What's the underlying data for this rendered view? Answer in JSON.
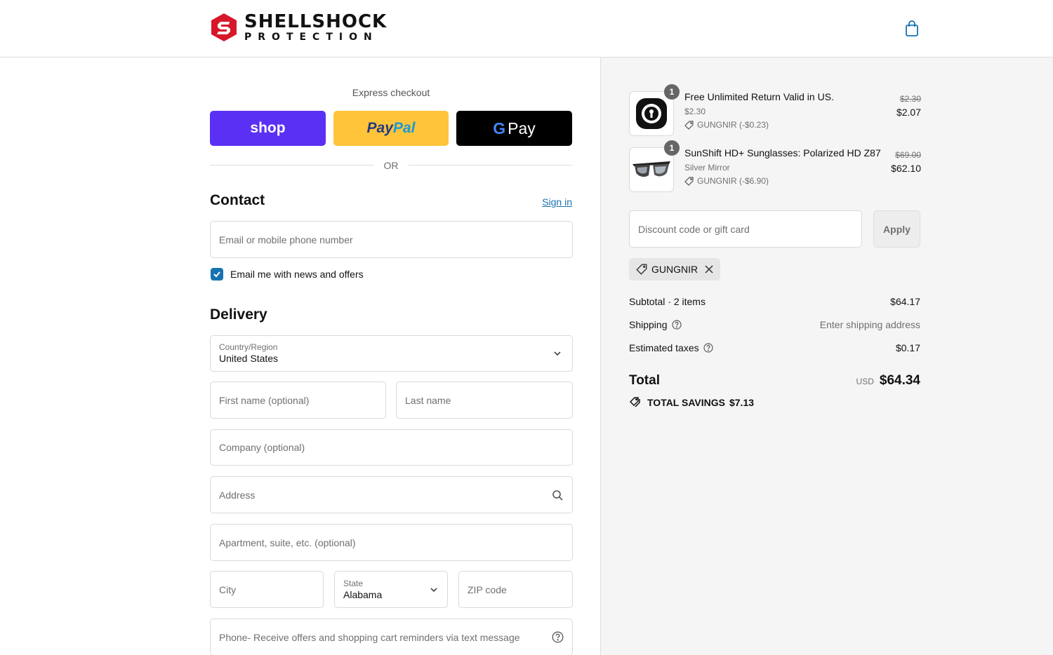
{
  "brand": {
    "name": "SHELLSHOCK",
    "sub": "PROTECTION",
    "color": "#d7182a"
  },
  "header": {
    "cart_icon": "shopping-bag-icon"
  },
  "express": {
    "label": "Express checkout",
    "shop_label": "shop",
    "paypal_pay": "Pay",
    "paypal_pal": "Pal",
    "gpay_g": "G",
    "gpay_label": "Pay",
    "or_label": "OR"
  },
  "contact": {
    "title": "Contact",
    "signin_label": "Sign in",
    "email_placeholder": "Email or mobile phone number",
    "newsletter_label": "Email me with news and offers",
    "newsletter_checked": true
  },
  "delivery": {
    "title": "Delivery",
    "country_label": "Country/Region",
    "country_value": "United States",
    "first_name_placeholder": "First name (optional)",
    "last_name_placeholder": "Last name",
    "company_placeholder": "Company (optional)",
    "address_placeholder": "Address",
    "apartment_placeholder": "Apartment, suite, etc. (optional)",
    "city_placeholder": "City",
    "state_label": "State",
    "state_value": "Alabama",
    "zip_placeholder": "ZIP code",
    "phone_placeholder": "Phone- Receive offers and shopping cart reminders via text message"
  },
  "summary": {
    "items": [
      {
        "name": "Free Unlimited Return Valid in US.",
        "variant": "$2.30",
        "discount": "GUNGNIR (-$0.23)",
        "old_price": "$2.30",
        "price": "$2.07",
        "qty": "1",
        "icon": "return-shield-icon"
      },
      {
        "name": "SunShift HD+ Sunglasses: Polarized HD Z87",
        "variant": "Silver Mirror",
        "discount": "GUNGNIR (-$6.90)",
        "old_price": "$69.00",
        "price": "$62.10",
        "qty": "1",
        "icon": "sunglasses-icon"
      }
    ],
    "discount_placeholder": "Discount code or gift card",
    "apply_label": "Apply",
    "applied_code": "GUNGNIR",
    "subtotal_label": "Subtotal · 2 items",
    "subtotal_value": "$64.17",
    "shipping_label": "Shipping",
    "shipping_value": "Enter shipping address",
    "taxes_label": "Estimated taxes",
    "taxes_value": "$0.17",
    "total_label": "Total",
    "total_currency": "USD",
    "total_value": "$64.34",
    "savings_label": "TOTAL SAVINGS",
    "savings_value": "$7.13"
  },
  "colors": {
    "accent": "#1773b0",
    "shop": "#5a31f4",
    "paypal": "#ffc439",
    "gpay": "#000000"
  }
}
